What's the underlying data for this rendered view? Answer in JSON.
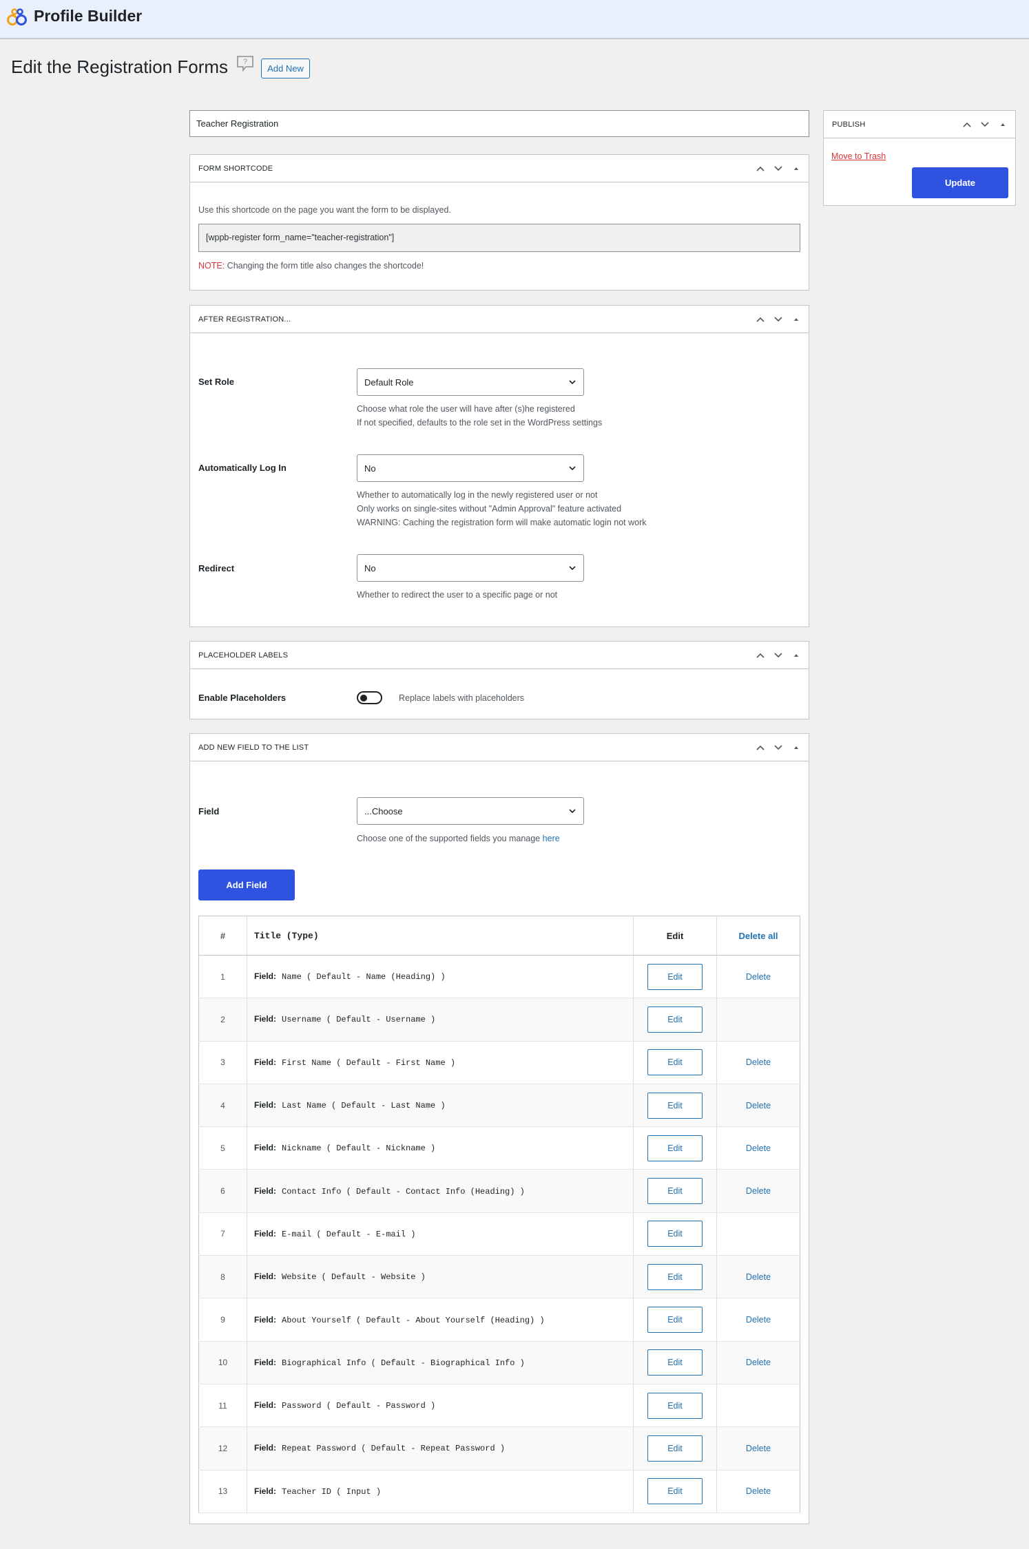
{
  "header": {
    "brand": "Profile Builder",
    "logo_icon": "profile-builder-logo-icon"
  },
  "page": {
    "title": "Edit the Registration Forms",
    "help_icon": "help-icon",
    "add_new_label": "Add New"
  },
  "form_title": {
    "value": "Teacher Registration"
  },
  "publish": {
    "title": "PUBLISH",
    "move_to_trash": "Move to Trash",
    "update_label": "Update"
  },
  "shortcode_box": {
    "title": "FORM SHORTCODE",
    "help": "Use this shortcode on the page you want the form to be displayed.",
    "shortcode": "[wppb-register form_name=\"teacher-registration\"]",
    "note_prefix": "NOTE:",
    "note_text": " Changing the form title also changes the shortcode!"
  },
  "after_registration": {
    "title": "AFTER REGISTRATION...",
    "set_role": {
      "label": "Set Role",
      "value": "Default Role",
      "help1": "Choose what role the user will have after (s)he registered",
      "help2": "If not specified, defaults to the role set in the WordPress settings"
    },
    "auto_login": {
      "label": "Automatically Log In",
      "value": "No",
      "help1": "Whether to automatically log in the newly registered user or not",
      "help2": "Only works on single-sites without \"Admin Approval\" feature activated",
      "help3": "WARNING: Caching the registration form will make automatic login not work"
    },
    "redirect": {
      "label": "Redirect",
      "value": "No",
      "help1": "Whether to redirect the user to a specific page or not"
    }
  },
  "placeholder_labels": {
    "title": "PLACEHOLDER LABELS",
    "label": "Enable Placeholders",
    "toggle_on": false,
    "toggle_text": "Replace labels with placeholders"
  },
  "add_field": {
    "title": "ADD NEW FIELD TO THE LIST",
    "field_label": "Field",
    "field_value": "...Choose",
    "help_prefix": "Choose one of the supported fields you manage ",
    "help_link": "here",
    "add_button": "Add Field"
  },
  "fields_table": {
    "headers": {
      "num": "#",
      "title": "Title (Type)",
      "edit": "Edit",
      "delete_all": "Delete all"
    },
    "field_prefix": "Field:",
    "edit_label": "Edit",
    "delete_label": "Delete",
    "rows": [
      {
        "num": "1",
        "title": "Name ( Default - Name (Heading) )",
        "deletable": true
      },
      {
        "num": "2",
        "title": "Username ( Default - Username )",
        "deletable": false
      },
      {
        "num": "3",
        "title": "First Name ( Default - First Name )",
        "deletable": true
      },
      {
        "num": "4",
        "title": "Last Name ( Default - Last Name )",
        "deletable": true
      },
      {
        "num": "5",
        "title": "Nickname ( Default - Nickname )",
        "deletable": true
      },
      {
        "num": "6",
        "title": "Contact Info ( Default - Contact Info (Heading) )",
        "deletable": true
      },
      {
        "num": "7",
        "title": "E-mail ( Default - E-mail )",
        "deletable": false
      },
      {
        "num": "8",
        "title": "Website ( Default - Website )",
        "deletable": true
      },
      {
        "num": "9",
        "title": "About Yourself ( Default - About Yourself (Heading) )",
        "deletable": true
      },
      {
        "num": "10",
        "title": "Biographical Info ( Default - Biographical Info )",
        "deletable": true
      },
      {
        "num": "11",
        "title": "Password ( Default - Password )",
        "deletable": false
      },
      {
        "num": "12",
        "title": "Repeat Password ( Default - Repeat Password )",
        "deletable": true
      },
      {
        "num": "13",
        "title": "Teacher ID ( Input )",
        "deletable": true
      }
    ]
  },
  "colors": {
    "primary": "#2f53e0",
    "link": "#2271b1",
    "danger": "#d63638"
  }
}
